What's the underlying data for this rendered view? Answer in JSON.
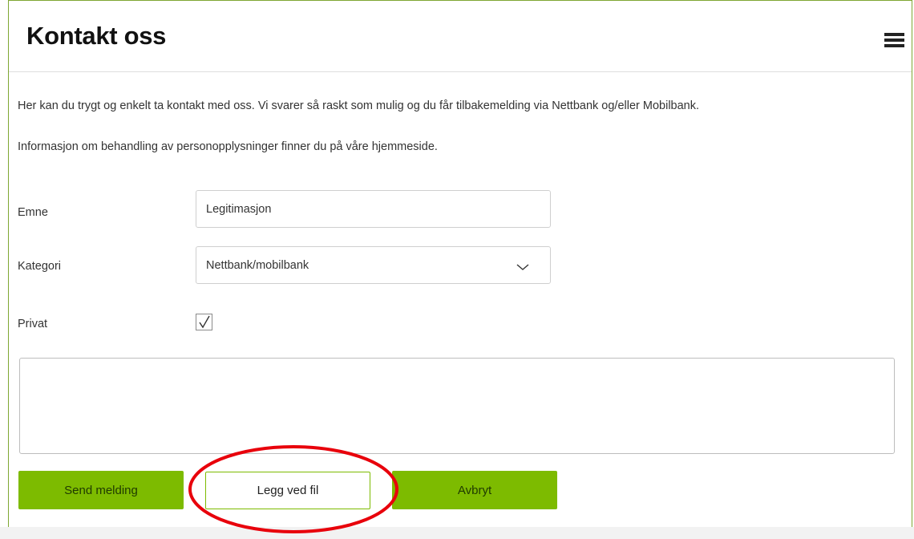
{
  "header": {
    "title": "Kontakt oss",
    "menu_icon": "hamburger-menu-icon"
  },
  "intro": {
    "line1": "Her kan du trygt og enkelt ta kontakt med oss. Vi svarer så raskt som mulig og du får tilbakemelding via Nettbank og/eller Mobilbank.",
    "line2": "Informasjon om behandling av personopplysninger finner du på våre hjemmeside."
  },
  "form": {
    "subject_label": "Emne",
    "subject_value": "Legitimasjon",
    "category_label": "Kategori",
    "category_value": "Nettbank/mobilbank",
    "private_label": "Privat",
    "private_checked": true,
    "message_value": ""
  },
  "buttons": {
    "send_label": "Send melding",
    "attach_label": "Legg ved fil",
    "cancel_label": "Avbryt"
  },
  "colors": {
    "accent_green": "#7dbb00",
    "frame_border": "#7fa733",
    "highlight_red": "#e8000b"
  }
}
